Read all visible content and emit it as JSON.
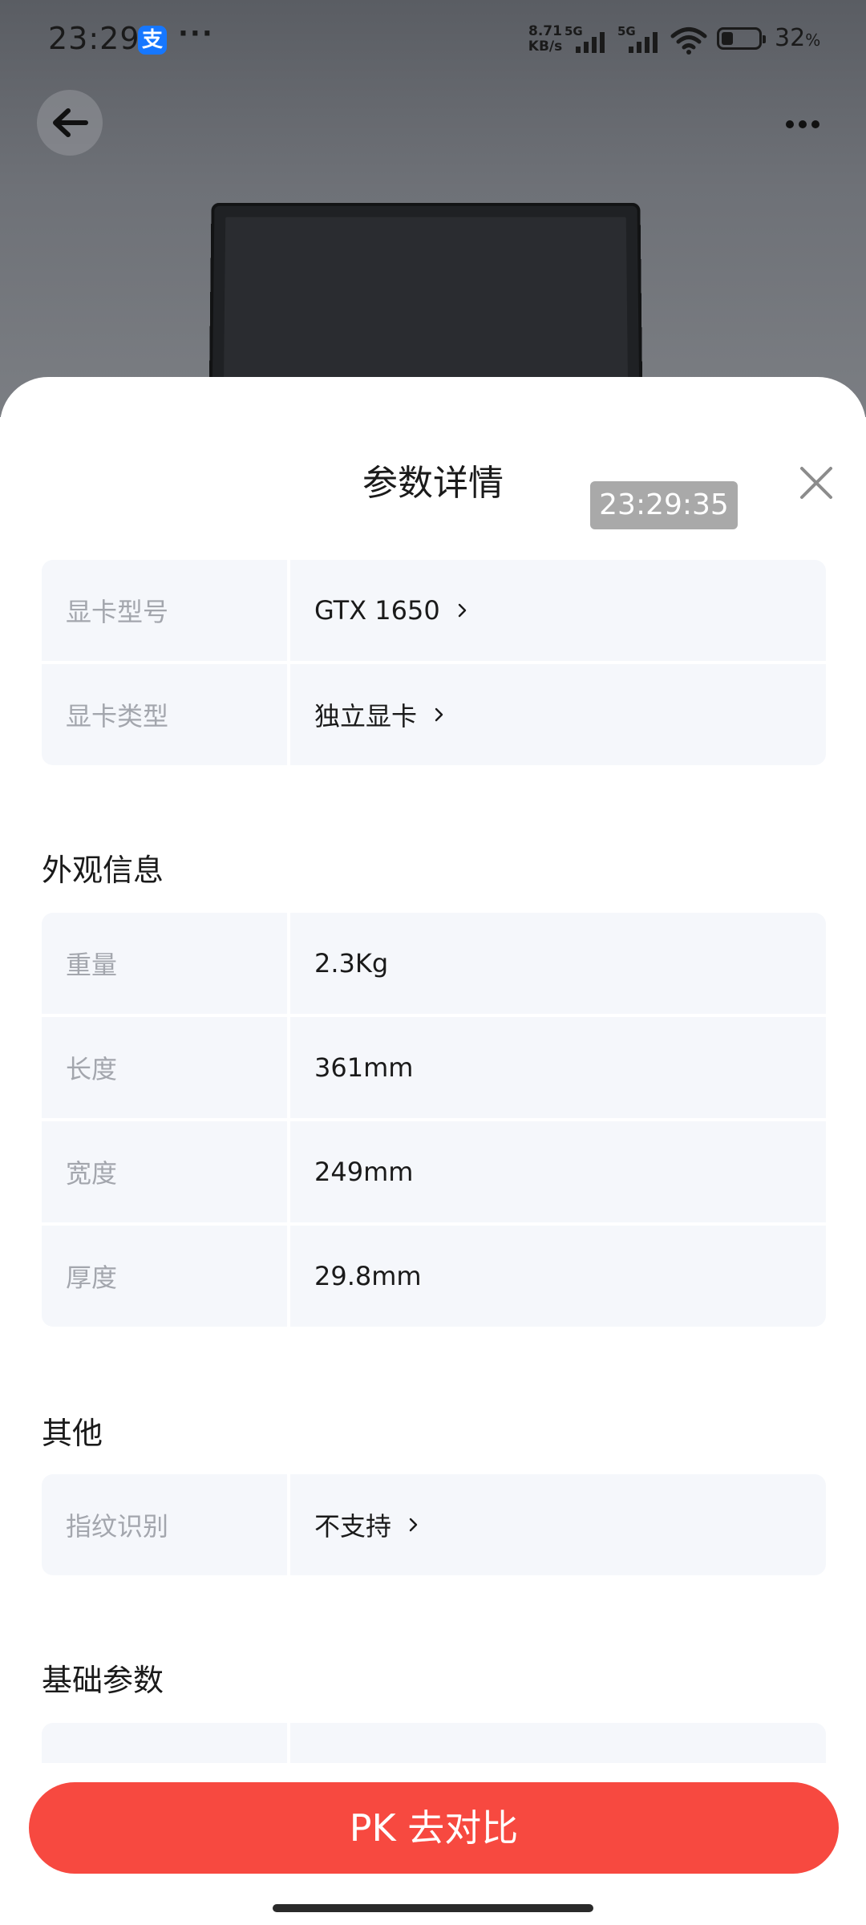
{
  "status_bar": {
    "time": "23:29",
    "app_icon_glyph": "支",
    "dots": "···",
    "net_speed_value": "8.71",
    "net_speed_unit": "KB/s",
    "sim1_label": "5G",
    "sim2_label": "5G",
    "battery_percent": "32",
    "battery_unit": "%",
    "battery_level": 0.32
  },
  "sheet": {
    "title": "参数详情",
    "time_overlay": "23:29:35"
  },
  "gpu_table": [
    {
      "label": "显卡型号",
      "value": "GTX 1650",
      "has_arrow": true
    },
    {
      "label": "显卡类型",
      "value": "独立显卡",
      "has_arrow": true
    }
  ],
  "sections": {
    "appearance": {
      "heading": "外观信息",
      "rows": [
        {
          "label": "重量",
          "value": "2.3Kg"
        },
        {
          "label": "长度",
          "value": "361mm"
        },
        {
          "label": "宽度",
          "value": "249mm"
        },
        {
          "label": "厚度",
          "value": "29.8mm"
        }
      ]
    },
    "other": {
      "heading": "其他",
      "rows": [
        {
          "label": "指纹识别",
          "value": "不支持",
          "has_arrow": true
        }
      ]
    },
    "basic": {
      "heading": "基础参数"
    }
  },
  "bottom_button": {
    "label": "PK 去对比"
  },
  "colors": {
    "accent": "#f74940",
    "row_bg": "#f5f7fb",
    "label_text": "#a3a6ad"
  }
}
